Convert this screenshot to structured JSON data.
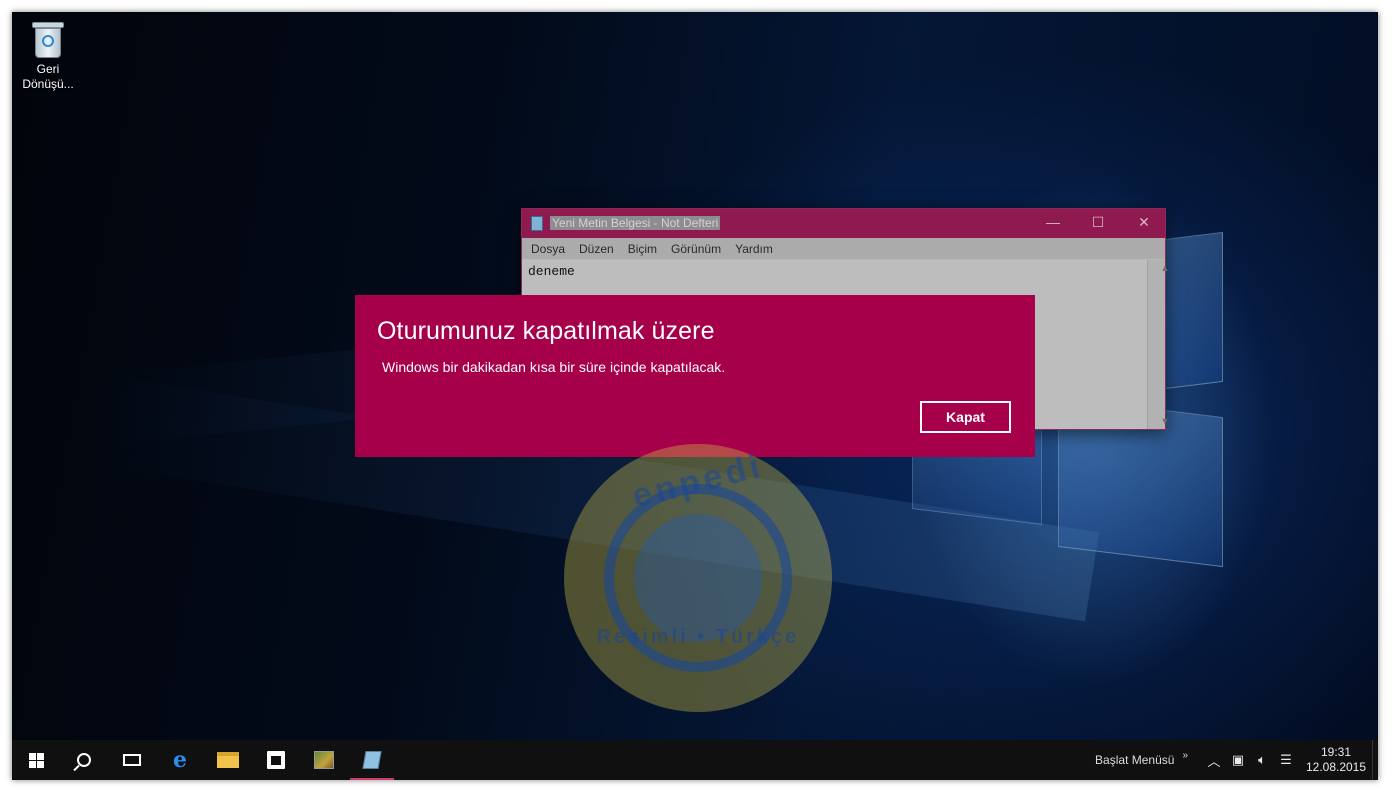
{
  "desktop": {
    "icons": [
      {
        "label": "Geri Dönüşü..."
      }
    ]
  },
  "notepad": {
    "title": "Yeni Metin Belgesi - Not Defteri",
    "menu": [
      "Dosya",
      "Düzen",
      "Biçim",
      "Görünüm",
      "Yardım"
    ],
    "content": "deneme",
    "window_buttons": {
      "minimize": "—",
      "maximize": "☐",
      "close": "✕"
    }
  },
  "dialog": {
    "title": "Oturumunuz kapatılmak üzere",
    "message": "Windows bir dakikadan kısa bir süre içinde kapatılacak.",
    "button": "Kapat",
    "color": "#a6004a"
  },
  "watermark": {
    "top": "enpedi",
    "bottom": "Resimli • Türkçe"
  },
  "taskbar": {
    "toolbar_label": "Başlat Menüsü",
    "toolbar_chevron": "»",
    "clock": {
      "time": "19:31",
      "date": "12.08.2015"
    },
    "tray_icons": [
      "chevron-up-icon",
      "network-icon",
      "volume-icon",
      "action-center-icon"
    ],
    "pinned": [
      "start-icon",
      "search-icon",
      "task-view-icon",
      "edge-icon",
      "file-explorer-icon",
      "store-icon",
      "app-icon",
      "notepad-icon"
    ]
  }
}
